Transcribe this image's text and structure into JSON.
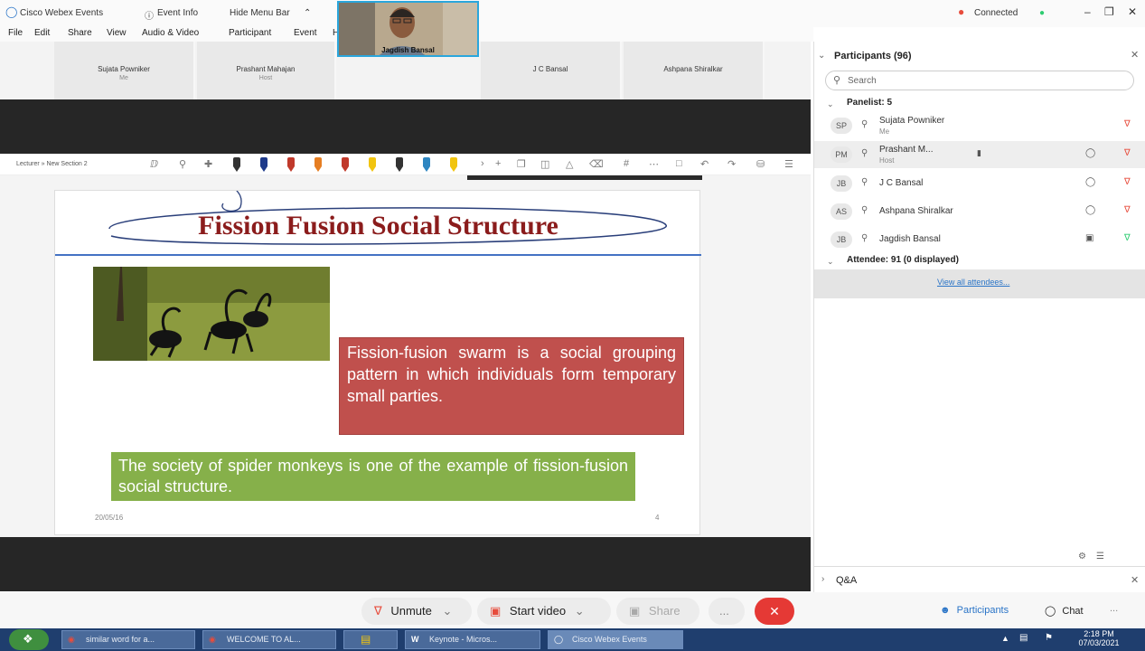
{
  "titlebar": {
    "app": "Cisco Webex Events",
    "event_info": "Event Info",
    "hide_menu": "Hide Menu Bar",
    "status": "Connected"
  },
  "menu": [
    "File",
    "Edit",
    "Share",
    "View",
    "Audio & Video",
    "Participant",
    "Event",
    "Help"
  ],
  "video_strip": [
    {
      "name": "Sujata Powniker",
      "sub": "Me"
    },
    {
      "name": "Prashant Mahajan",
      "sub": "Host"
    },
    {
      "name": "Jagdish Bansal",
      "sub": ""
    },
    {
      "name": "J C Bansal",
      "sub": ""
    },
    {
      "name": "Ashpana Shiralkar",
      "sub": ""
    }
  ],
  "toolbar": {
    "breadcrumb": "Lecturer » New Section 2"
  },
  "pen_colors": [
    "#333333",
    "#1e3a8a",
    "#c0392b",
    "#e67e22",
    "#c0392b",
    "#f1c40f",
    "#333333",
    "#2e86c1",
    "#f1c40f"
  ],
  "slide": {
    "title": "Fission Fusion Social Structure",
    "red_text": "Fission-fusion swarm is a social grouping pattern in which individuals form temporary small parties.",
    "green_text": "The society of spider monkeys is one of the example of fission-fusion social structure.",
    "date": "20/05/16",
    "page": "4",
    "colors": {
      "title": "#8b1c1c",
      "red_box": "#c0504d",
      "green_box": "#86b04a",
      "rule": "#4472c4"
    }
  },
  "participants": {
    "header": "Participants (96)",
    "search_placeholder": "Search",
    "panelist_header": "Panelist: 5",
    "panelists": [
      {
        "initials": "SP",
        "name": "Sujata Powniker",
        "sub": "Me"
      },
      {
        "initials": "PM",
        "name": "Prashant M...",
        "sub": "Host"
      },
      {
        "initials": "JB",
        "name": "J C Bansal",
        "sub": ""
      },
      {
        "initials": "AS",
        "name": "Ashpana Shiralkar",
        "sub": ""
      },
      {
        "initials": "JB",
        "name": "Jagdish Bansal",
        "sub": ""
      }
    ],
    "attendee_header": "Attendee: 91 (0 displayed)",
    "view_all": "View all attendees..."
  },
  "qa_label": "Q&A",
  "controls": {
    "unmute": "Unmute",
    "start_video": "Start video",
    "share": "Share",
    "more": "...",
    "participants": "Participants",
    "chat": "Chat"
  },
  "taskbar": {
    "items": [
      "similar word for a...",
      "WELCOME TO AL...",
      "",
      "Keynote - Micros...",
      "Cisco Webex Events"
    ],
    "time": "2:18 PM",
    "date": "07/03/2021"
  }
}
